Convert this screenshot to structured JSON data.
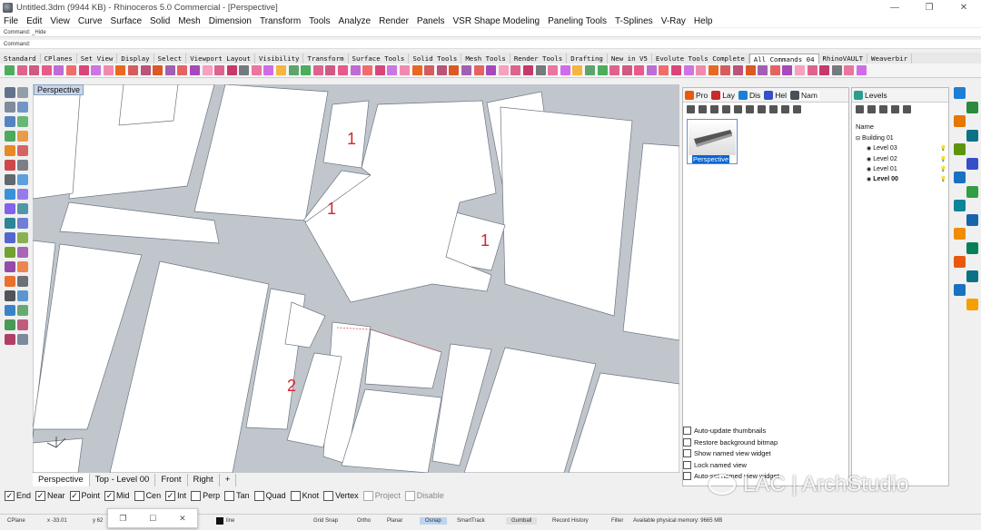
{
  "window": {
    "title": "Untitled.3dm (9944 KB) - Rhinoceros 5.0 Commercial - [Perspective]",
    "min": "—",
    "max": "❐",
    "close": "✕"
  },
  "menu": [
    "File",
    "Edit",
    "View",
    "Curve",
    "Surface",
    "Solid",
    "Mesh",
    "Dimension",
    "Transform",
    "Tools",
    "Analyze",
    "Render",
    "Panels",
    "VSR Shape Modeling",
    "Paneling Tools",
    "T-Splines",
    "V-Ray",
    "Help"
  ],
  "command": {
    "history": "Command: _Hide",
    "prompt": "Command:"
  },
  "toolbar_tabs": [
    "Standard",
    "CPlanes",
    "Set View",
    "Display",
    "Select",
    "Viewport Layout",
    "Visibility",
    "Transform",
    "Surface Tools",
    "Solid Tools",
    "Mesh Tools",
    "Render Tools",
    "Drafting",
    "New in V5",
    "Evolute Tools Complete",
    "All Commands 04",
    "RhinoVAULT",
    "Weaverbir"
  ],
  "active_toolbar_tab": "All Commands 04",
  "viewport": {
    "title": "Perspective",
    "room_labels": [
      "1",
      "1",
      "1",
      "2"
    ],
    "label_color": "#d8232a"
  },
  "viewport_tabs": [
    "Perspective",
    "Top - Level 00",
    "Front",
    "Right",
    "+"
  ],
  "active_viewport_tab": "Perspective",
  "osnap": [
    {
      "label": "End",
      "checked": true
    },
    {
      "label": "Near",
      "checked": true
    },
    {
      "label": "Point",
      "checked": true
    },
    {
      "label": "Mid",
      "checked": true
    },
    {
      "label": "Cen",
      "checked": false
    },
    {
      "label": "Int",
      "checked": true
    },
    {
      "label": "Perp",
      "checked": false
    },
    {
      "label": "Tan",
      "checked": false
    },
    {
      "label": "Quad",
      "checked": false
    },
    {
      "label": "Knot",
      "checked": false
    },
    {
      "label": "Vertex",
      "checked": false
    },
    {
      "label": "Project",
      "checked": false,
      "disabled": true
    },
    {
      "label": "Disable",
      "checked": false,
      "disabled": true
    }
  ],
  "status": {
    "cplane": "CPlane",
    "x": "x -33.01",
    "y": "y 62",
    "layer": "line",
    "items": [
      "Grid Snap",
      "Ortho",
      "Planar",
      "Osnap",
      "SmartTrack",
      "Gumball",
      "Record History",
      "Filter",
      "Available physical memory: 9665 MB"
    ]
  },
  "named_views": {
    "tabs": [
      "Pro",
      "Lay",
      "Dis",
      "Hel",
      "Nam"
    ],
    "thumb_label": "Perspective",
    "options": [
      "Auto-update thumbnails",
      "Restore background bitmap",
      "Show named view widget",
      "Lock named view",
      "Auto-set named view widget"
    ]
  },
  "layers": {
    "tab": "Levels",
    "header": "Name",
    "items": [
      "Building 01",
      "Level 03",
      "Level 02",
      "Level 01",
      "Level 00"
    ],
    "current": "Level 00"
  },
  "watermark": {
    "text": "LAC | ArchStudio"
  },
  "colors": {
    "viewport_bg": "#a8bcd0",
    "slab": "#ffffff",
    "wall": "#c0c6cc",
    "accent": "#0a64d0"
  }
}
